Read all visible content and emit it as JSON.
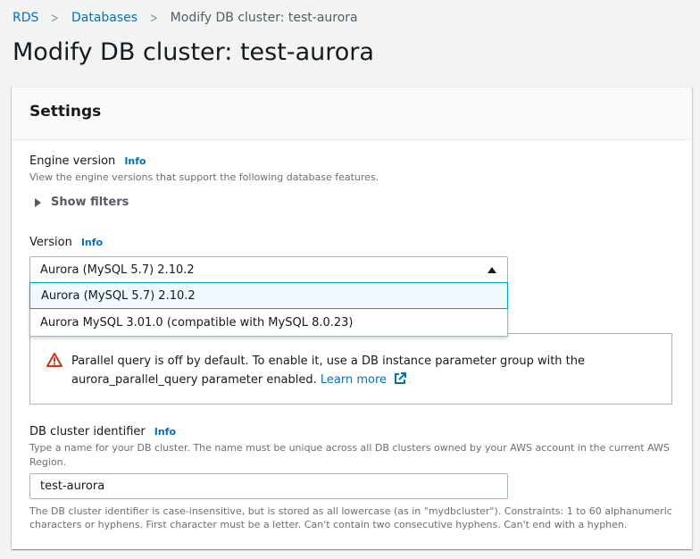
{
  "breadcrumb": {
    "items": [
      "RDS",
      "Databases"
    ],
    "current": "Modify DB cluster: test-aurora"
  },
  "page": {
    "title": "Modify DB cluster: test-aurora"
  },
  "settings": {
    "title": "Settings",
    "engine_version": {
      "label": "Engine version",
      "info": "Info",
      "description": "View the engine versions that support the following database features.",
      "show_filters": "Show filters"
    },
    "version": {
      "label": "Version",
      "info": "Info",
      "selected": "Aurora (MySQL 5.7) 2.10.2",
      "options": [
        "Aurora (MySQL 5.7) 2.10.2",
        "Aurora MySQL 3.01.0 (compatible with MySQL 8.0.23)"
      ]
    },
    "alert": {
      "text": "Parallel query is off by default. To enable it, use a DB instance parameter group with the aurora_parallel_query parameter enabled.",
      "link": "Learn more"
    },
    "cluster_identifier": {
      "label": "DB cluster identifier",
      "info": "Info",
      "description": "Type a name for your DB cluster. The name must be unique across all DB clusters owned by your AWS account in the current AWS Region.",
      "value": "test-aurora",
      "constraint": "The DB cluster identifier is case-insensitive, but is stored as all lowercase (as in \"mydbcluster\"). Constraints: 1 to 60 alphanumeric characters or hyphens. First character must be a letter. Can't contain two consecutive hyphens. Can't end with a hyphen."
    }
  },
  "icons": {
    "breadcrumb_separator": "chevron-right-icon",
    "filters_toggle": "caret-right-icon",
    "select_open": "caret-up-icon",
    "alert": "warning-icon",
    "external": "external-link-icon"
  },
  "colors": {
    "link": "#0073bb",
    "warning": "#d13212",
    "focus": "#00a1c9"
  }
}
